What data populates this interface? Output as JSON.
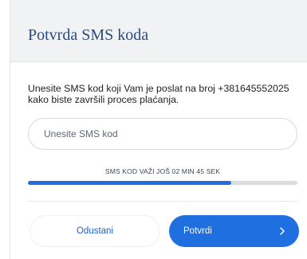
{
  "dialog": {
    "title": "Potvrda SMS koda",
    "message": "Unesite SMS kod koji Vam je poslat na broj +381645552025 kako biste završili proces plaćanja.",
    "input": {
      "placeholder": "Unesite SMS kod",
      "value": ""
    },
    "timer_text": "SMS KOD VAŽI JOŠ 02 MIN 45 SEK",
    "progress_fraction": 0.755,
    "cancel_label": "Odustani",
    "confirm_label": "Potvrdi",
    "confirm_icon": "chevron-right-icon"
  },
  "colors": {
    "accent": "#1f6fe0",
    "title": "#2b4a82",
    "header_bg": "#f1f2f4"
  }
}
